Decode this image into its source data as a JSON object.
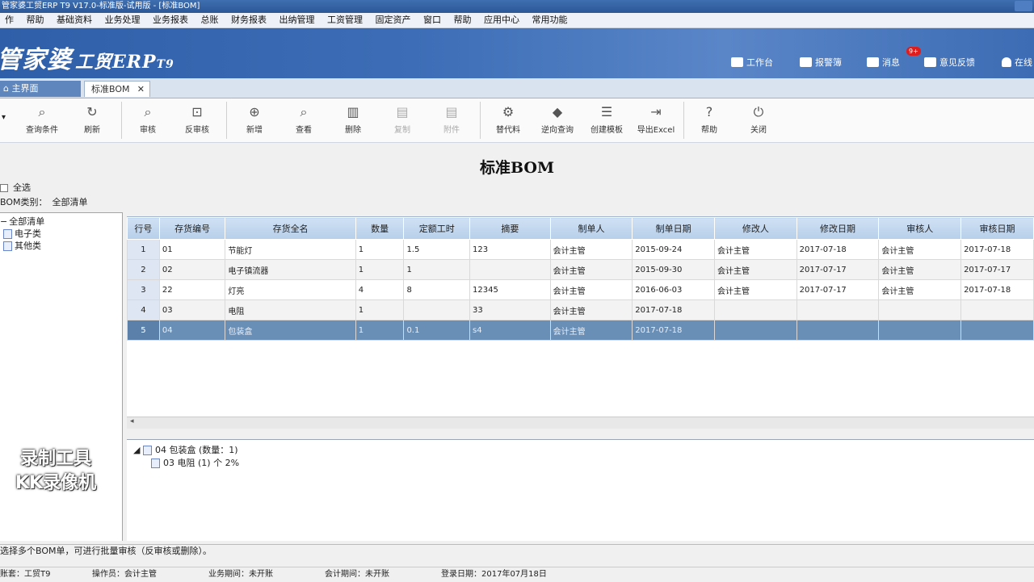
{
  "window": {
    "title": "管家婆工贸ERP T9 V17.0-标准版-试用版 - [标准BOM]"
  },
  "menu": [
    "作",
    "帮助",
    "基础资料",
    "业务处理",
    "业务报表",
    "总账",
    "财务报表",
    "出纳管理",
    "工资管理",
    "固定资产",
    "窗口",
    "帮助",
    "应用中心",
    "常用功能"
  ],
  "banner": {
    "logo_main": "管家婆",
    "logo_sub": "工贸ERP",
    "logo_ver": "T9",
    "links": {
      "workbench": "工作台",
      "alerts": "报警簿",
      "messages": "消息",
      "message_count": "9+",
      "feedback": "意见反馈",
      "online": "在线"
    }
  },
  "tabs": {
    "home": "主界面",
    "bom": "标准BOM",
    "close": "✕"
  },
  "toolbar": {
    "query": "查询条件",
    "refresh": "刷新",
    "audit": "审核",
    "unaudit": "反审核",
    "add": "新增",
    "view": "查看",
    "delete": "删除",
    "copy": "复制",
    "attach": "附件",
    "substitute": "替代料",
    "reverse": "逆向查询",
    "template": "创建模板",
    "export": "导出Excel",
    "help": "帮助",
    "close": "关闭"
  },
  "doc_title": "标准BOM",
  "select_all": "全选",
  "category": {
    "label": "BOM类别",
    "value": "全部清单"
  },
  "tree": {
    "root": "全部清单",
    "children": [
      "电子类",
      "其他类"
    ]
  },
  "grid": {
    "columns": [
      "行号",
      "存货编号",
      "存货全名",
      "数量",
      "定额工时",
      "摘要",
      "制单人",
      "制单日期",
      "修改人",
      "修改日期",
      "审核人",
      "审核日期"
    ],
    "rows": [
      [
        "1",
        "01",
        "节能灯",
        "1",
        "1.5",
        "123",
        "会计主管",
        "2015-09-24",
        "会计主管",
        "2017-07-18",
        "会计主管",
        "2017-07-18"
      ],
      [
        "2",
        "02",
        "电子镇流器",
        "1",
        "1",
        "",
        "会计主管",
        "2015-09-30",
        "会计主管",
        "2017-07-17",
        "会计主管",
        "2017-07-17"
      ],
      [
        "3",
        "22",
        "灯亮",
        "4",
        "8",
        "12345",
        "会计主管",
        "2016-06-03",
        "会计主管",
        "2017-07-17",
        "会计主管",
        "2017-07-18"
      ],
      [
        "4",
        "03",
        "电阻",
        "1",
        "",
        "33",
        "会计主管",
        "2017-07-18",
        "",
        "",
        "",
        ""
      ],
      [
        "5",
        "04",
        "包装盒",
        "1",
        "0.1",
        "s4",
        "会计主管",
        "2017-07-18",
        "",
        "",
        "",
        ""
      ]
    ]
  },
  "bom_tree": {
    "parent": "04 包装盒 (数量：1)",
    "child": "03 电阻 (1) 个 2%"
  },
  "watermark": {
    "line1": "录制工具",
    "line2": "KK录像机"
  },
  "hint": "选择多个BOM单，可进行批量审核（反审核或删除）。",
  "status": {
    "account": "账套：工贸T9",
    "operator": "操作员：会计主管",
    "biz_period": "业务期间：未开账",
    "acc_period": "会计期间：未开账",
    "login_date": "登录日期：2017年07月18日"
  }
}
